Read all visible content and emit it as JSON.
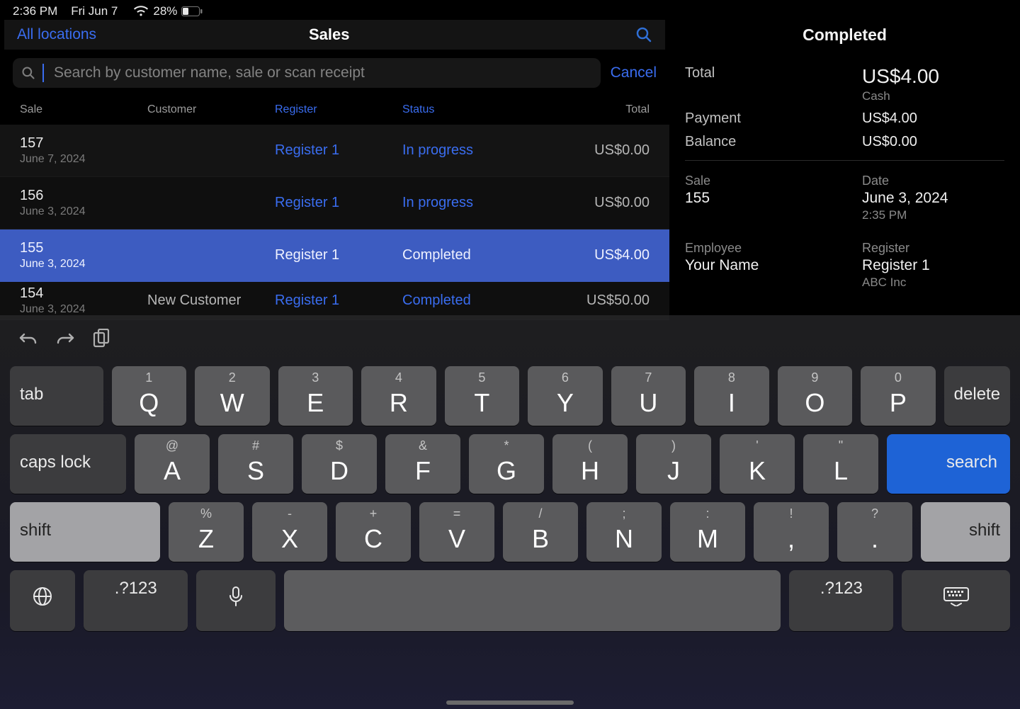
{
  "statusbar": {
    "time": "2:36 PM",
    "date": "Fri Jun 7",
    "battery": "28%"
  },
  "nav": {
    "locations": "All locations",
    "title": "Sales",
    "cancel": "Cancel"
  },
  "search": {
    "placeholder": "Search by customer name, sale or scan receipt"
  },
  "headers": {
    "sale": "Sale",
    "customer": "Customer",
    "register": "Register",
    "status": "Status",
    "total": "Total"
  },
  "rows": [
    {
      "id": "157",
      "date": "June 7, 2024",
      "customer": "",
      "register": "Register 1",
      "status": "In progress",
      "total": "US$0.00",
      "selected": false,
      "alt": false
    },
    {
      "id": "156",
      "date": "June 3, 2024",
      "customer": "",
      "register": "Register 1",
      "status": "In progress",
      "total": "US$0.00",
      "selected": false,
      "alt": true
    },
    {
      "id": "155",
      "date": "June 3, 2024",
      "customer": "",
      "register": "Register 1",
      "status": "Completed",
      "total": "US$4.00",
      "selected": true,
      "alt": false
    },
    {
      "id": "154",
      "date": "June 3, 2024",
      "customer": "New Customer",
      "register": "Register 1",
      "status": "Completed",
      "total": "US$50.00",
      "selected": false,
      "alt": true
    }
  ],
  "detail": {
    "title": "Completed",
    "total_label": "Total",
    "total": "US$4.00",
    "total_sub": "Cash",
    "payment_label": "Payment",
    "payment": "US$4.00",
    "balance_label": "Balance",
    "balance": "US$0.00",
    "sale_label": "Sale",
    "sale": "155",
    "date_label": "Date",
    "date": "June 3, 2024",
    "date_sub": "2:35 PM",
    "employee_label": "Employee",
    "employee": "Your Name",
    "register_label": "Register",
    "register": "Register 1",
    "register_sub": "ABC Inc"
  },
  "kbd": {
    "tab": "tab",
    "delete": "delete",
    "caps": "caps lock",
    "search": "search",
    "shift": "shift",
    "dotnum": ".?123",
    "row1": [
      {
        "h": "1",
        "m": "Q"
      },
      {
        "h": "2",
        "m": "W"
      },
      {
        "h": "3",
        "m": "E"
      },
      {
        "h": "4",
        "m": "R"
      },
      {
        "h": "5",
        "m": "T"
      },
      {
        "h": "6",
        "m": "Y"
      },
      {
        "h": "7",
        "m": "U"
      },
      {
        "h": "8",
        "m": "I"
      },
      {
        "h": "9",
        "m": "O"
      },
      {
        "h": "0",
        "m": "P"
      }
    ],
    "row2": [
      {
        "h": "@",
        "m": "A"
      },
      {
        "h": "#",
        "m": "S"
      },
      {
        "h": "$",
        "m": "D"
      },
      {
        "h": "&",
        "m": "F"
      },
      {
        "h": "*",
        "m": "G"
      },
      {
        "h": "(",
        "m": "H"
      },
      {
        "h": ")",
        "m": "J"
      },
      {
        "h": "'",
        "m": "K"
      },
      {
        "h": "\"",
        "m": "L"
      }
    ],
    "row3": [
      {
        "h": "%",
        "m": "Z"
      },
      {
        "h": "-",
        "m": "X"
      },
      {
        "h": "+",
        "m": "C"
      },
      {
        "h": "=",
        "m": "V"
      },
      {
        "h": "/",
        "m": "B"
      },
      {
        "h": ";",
        "m": "N"
      },
      {
        "h": ":",
        "m": "M"
      },
      {
        "h": "!",
        "m": ","
      },
      {
        "h": "?",
        "m": "."
      }
    ]
  }
}
